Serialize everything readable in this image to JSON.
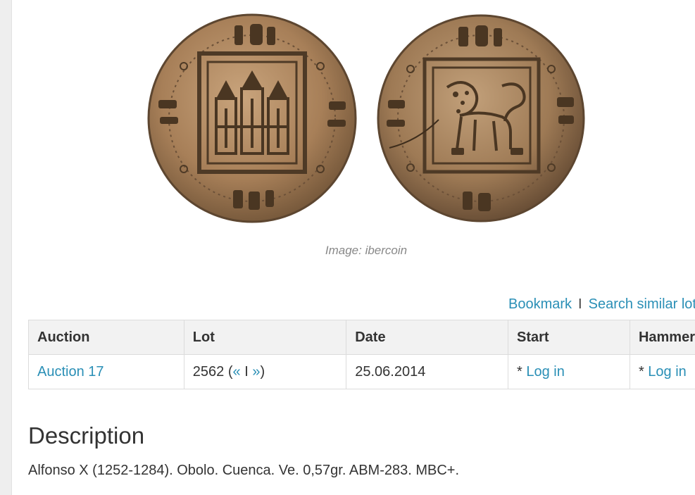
{
  "image": {
    "alt": "Coin obverse and reverse",
    "caption": "Image: ibercoin",
    "colors": {
      "coin_bronze": "#a77f58",
      "coin_dark": "#5d4630",
      "coin_light": "#c9a47c"
    }
  },
  "actions": {
    "bookmark": "Bookmark",
    "separator": "I",
    "search_similar": "Search similar lot"
  },
  "table": {
    "headers": [
      "Auction",
      "Lot",
      "Date",
      "Start",
      "Hammer"
    ],
    "row": {
      "auction": "Auction 17",
      "lot_number": "2562",
      "lot_open": "(",
      "prev": "«",
      "lot_sep": "I",
      "next": "»",
      "lot_close": ")",
      "date": "25.06.2014",
      "start_prefix": "* ",
      "start_link": "Log in",
      "hammer_prefix": "* ",
      "hammer_link": "Log in"
    }
  },
  "description": {
    "title": "Description",
    "text": "Alfonso X (1252-1284). Obolo. Cuenca. Ve. 0,57gr. ABM-283. MBC+."
  },
  "colors": {
    "link": "#2a8fb6",
    "header_bg": "#f2f2f2",
    "border": "#dcdcdc",
    "text": "#333333"
  }
}
